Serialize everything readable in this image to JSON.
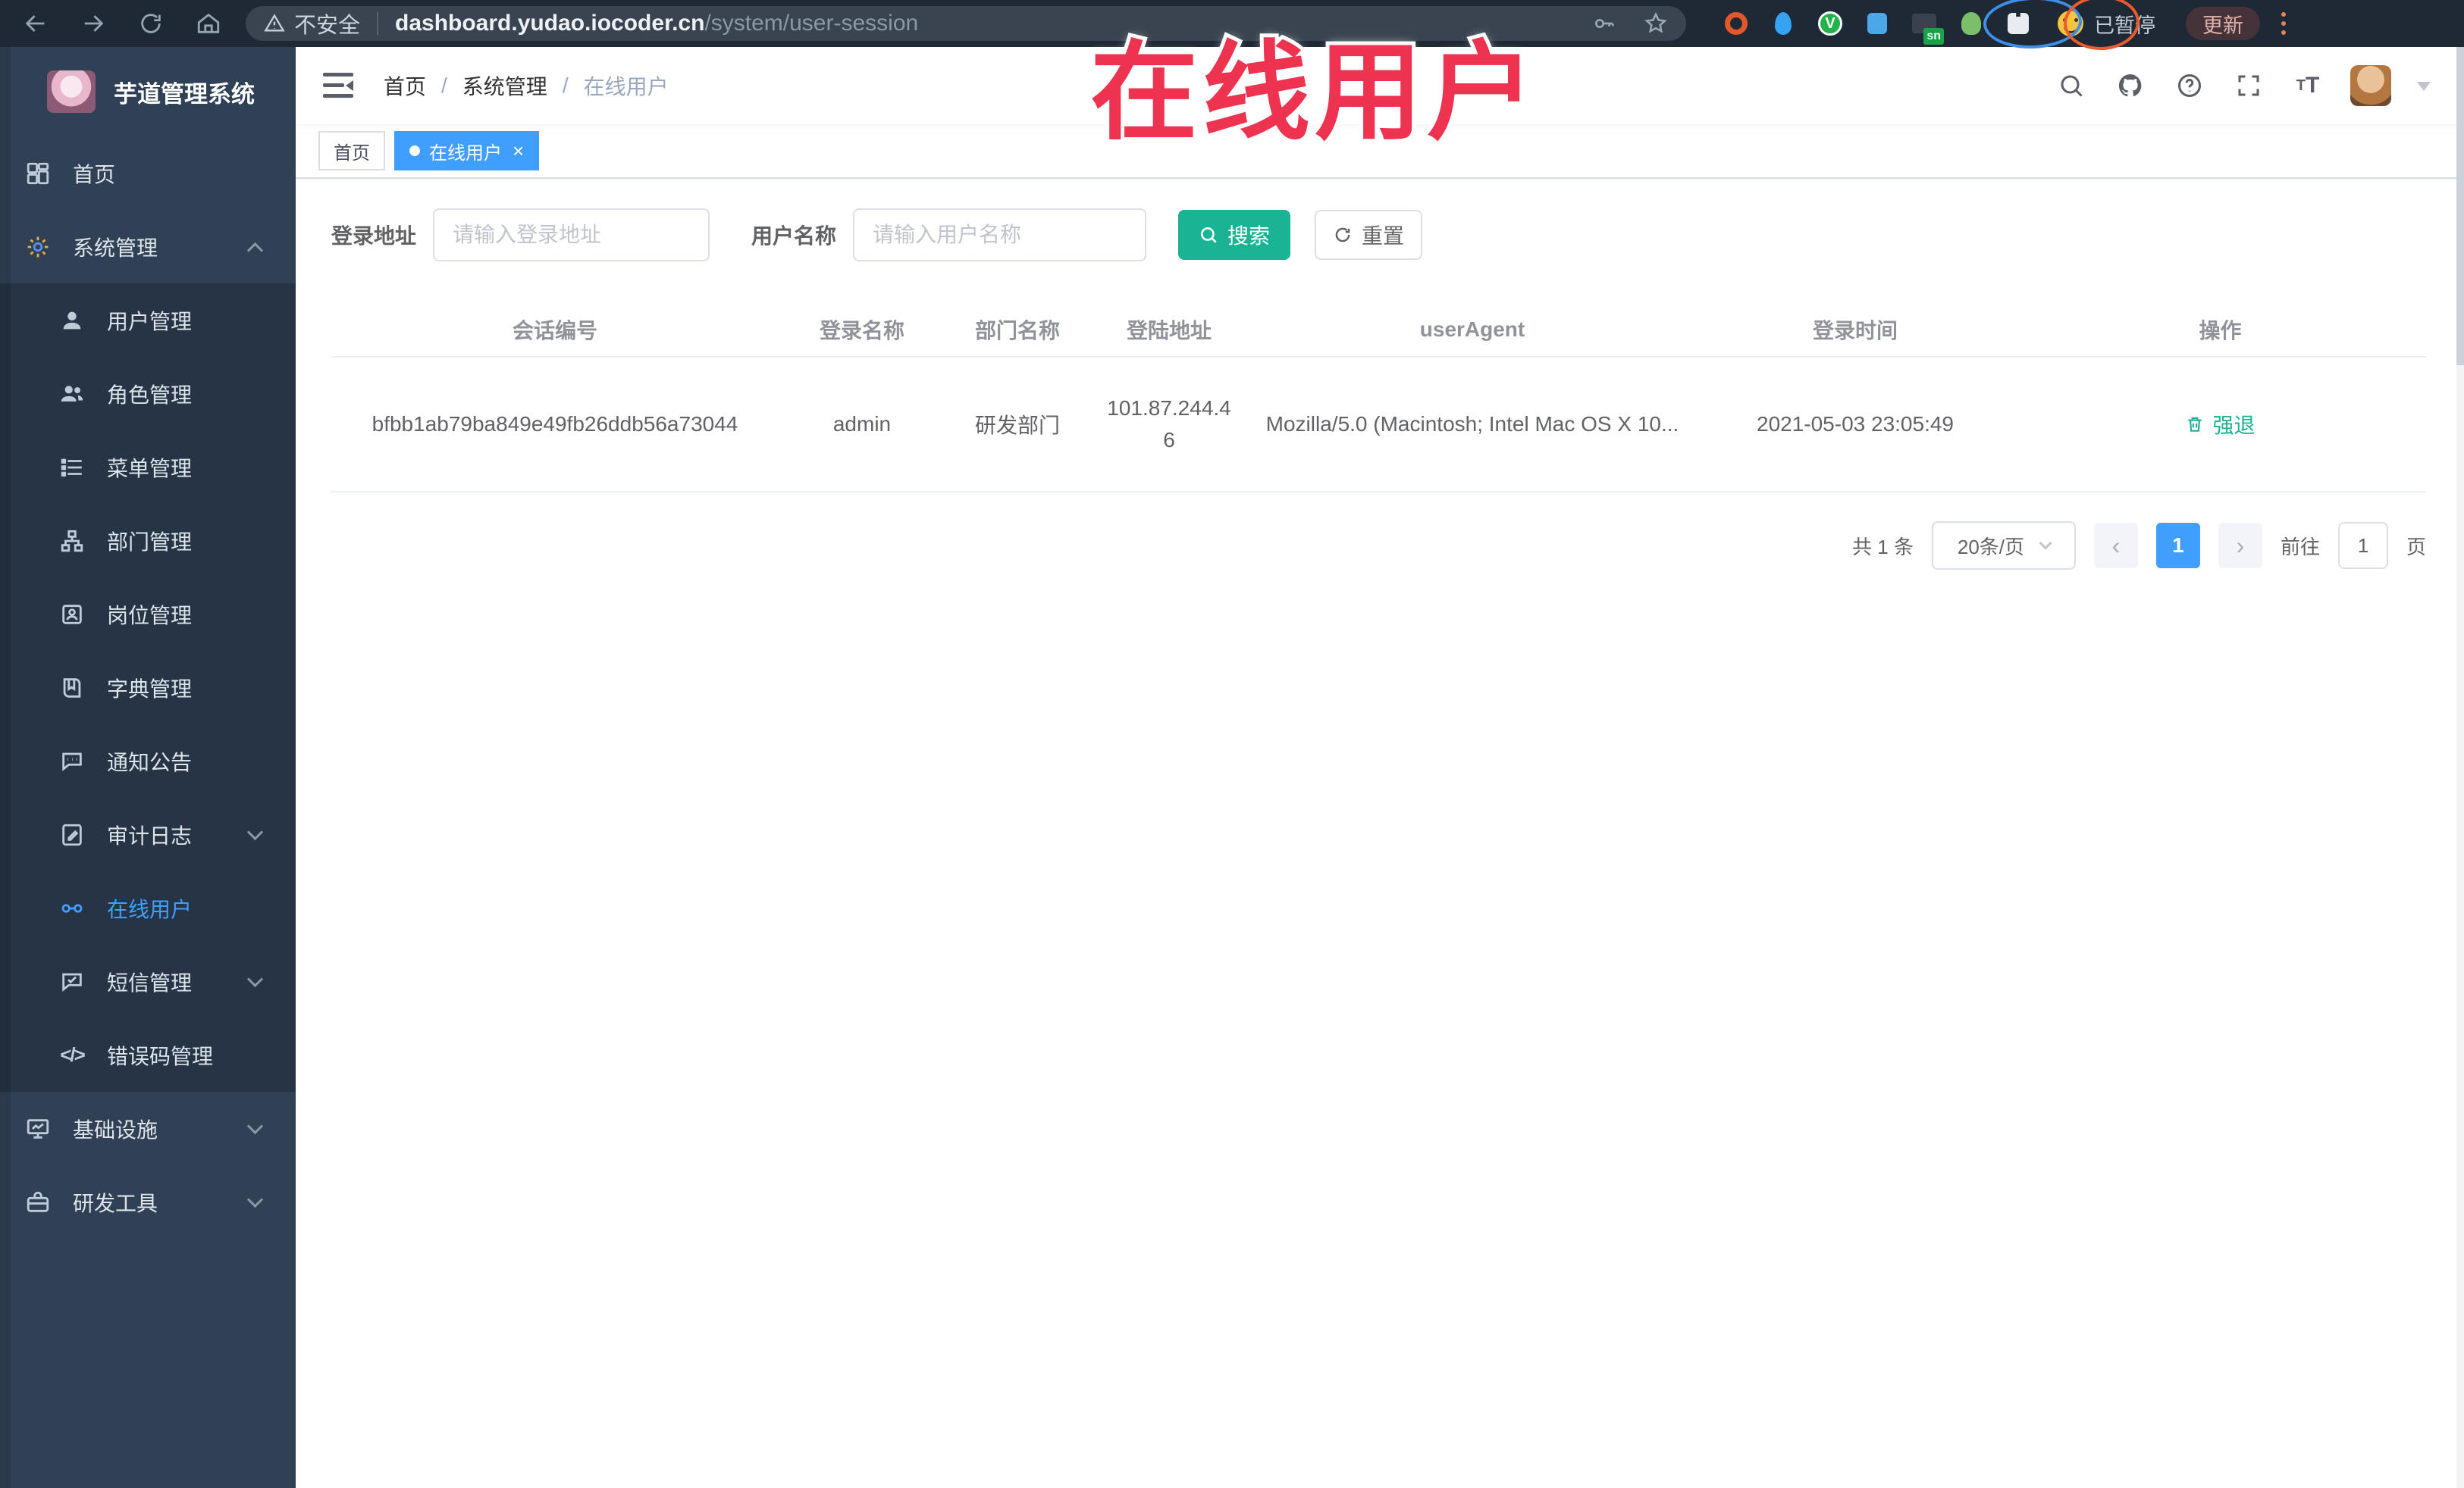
{
  "browser": {
    "security_label": "不安全",
    "url_host": "dashboard.yudao.iocoder.cn",
    "url_path": "/system/user-session",
    "extension_badge": "sn",
    "paused_label": "已暂停",
    "update_label": "更新"
  },
  "annotation": {
    "title": "在线用户"
  },
  "sidebar": {
    "title": "芋道管理系统",
    "items": [
      {
        "label": "首页"
      },
      {
        "label": "系统管理"
      },
      {
        "label": "用户管理"
      },
      {
        "label": "角色管理"
      },
      {
        "label": "菜单管理"
      },
      {
        "label": "部门管理"
      },
      {
        "label": "岗位管理"
      },
      {
        "label": "字典管理"
      },
      {
        "label": "通知公告"
      },
      {
        "label": "审计日志"
      },
      {
        "label": "在线用户"
      },
      {
        "label": "短信管理"
      },
      {
        "label": "错误码管理"
      },
      {
        "label": "基础设施"
      },
      {
        "label": "研发工具"
      }
    ]
  },
  "breadcrumb": {
    "home": "首页",
    "section": "系统管理",
    "current": "在线用户"
  },
  "tabs": {
    "home": "首页",
    "current": "在线用户"
  },
  "filters": {
    "address_label": "登录地址",
    "address_placeholder": "请输入登录地址",
    "name_label": "用户名称",
    "name_placeholder": "请输入用户名称",
    "search_label": "搜索",
    "reset_label": "重置"
  },
  "table": {
    "columns": {
      "session": "会话编号",
      "login_name": "登录名称",
      "dept": "部门名称",
      "login_addr": "登陆地址",
      "user_agent": "userAgent",
      "login_time": "登录时间",
      "actions": "操作"
    },
    "row": {
      "session_id": "bfbb1ab79ba849e49fb26ddb56a73044",
      "login_name": "admin",
      "dept": "研发部门",
      "login_addr": "101.87.244.46",
      "user_agent": "Mozilla/5.0 (Macintosh; Intel Mac OS X 10...",
      "login_time": "2021-05-03 23:05:49",
      "action_label": "强退"
    }
  },
  "pagination": {
    "total": "共 1 条",
    "page_size": "20条/页",
    "page": "1",
    "goto_label": "前往",
    "goto_value": "1",
    "unit_label": "页"
  },
  "colors": {
    "accent": "#409eff",
    "success": "#1ab394",
    "annotation_red": "#ee3350",
    "sidebar_bg": "#304156",
    "submenu_bg": "#263445"
  }
}
